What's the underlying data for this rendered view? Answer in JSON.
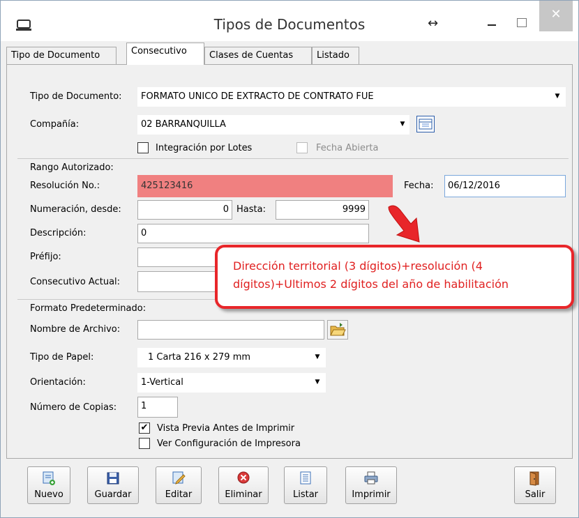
{
  "window": {
    "title": "Tipos de Documentos",
    "resize_glyph": "↔",
    "close_glyph": "✕"
  },
  "tabs": [
    {
      "label": "Tipo de Documento",
      "active": false
    },
    {
      "label": "Consecutivo",
      "active": true
    },
    {
      "label": "Clases de Cuentas",
      "active": false
    },
    {
      "label": "Listado",
      "active": false
    }
  ],
  "form": {
    "tipo_documento_label": "Tipo de Documento:",
    "tipo_documento_value": "FORMATO UNICO DE EXTRACTO DE CONTRATO FUE",
    "compania_label": "Compañía:",
    "compania_value": "02 BARRANQUILLA",
    "integracion_label": "Integración por Lotes",
    "integracion_checked": false,
    "fecha_abierta_label": "Fecha Abierta",
    "fecha_abierta_checked": false,
    "rango_section": "Rango Autorizado:",
    "resolucion_label": "Resolución No.:",
    "resolucion_value": "425123416",
    "fecha_label": "Fecha:",
    "fecha_value": "06/12/2016",
    "numeracion_label": "Numeración, desde:",
    "numeracion_desde": "0",
    "hasta_label": "Hasta:",
    "hasta_value": "9999",
    "descripcion_label": "Descripción:",
    "descripcion_value": "0",
    "prefijo_label": "Préfijo:",
    "prefijo_value": "",
    "consecutivo_actual_label": "Consecutivo Actual:",
    "consecutivo_actual_value": "",
    "formato_section": "Formato Predeterminado:",
    "nombre_archivo_label": "Nombre de Archivo:",
    "nombre_archivo_value": "",
    "tipo_papel_label": "Tipo de Papel:",
    "tipo_papel_value": "1  Carta 216 x 279 mm",
    "orientacion_label": "Orientación:",
    "orientacion_value": "1-Vertical",
    "copias_label": "Número de Copias:",
    "copias_value": "1",
    "vista_previa_label": "Vista Previa Antes de Imprimir",
    "vista_previa_checked": true,
    "ver_config_label": "Ver Configuración de Impresora",
    "ver_config_checked": false,
    "check_glyph": "✔"
  },
  "callout": {
    "line1": "Dirección territorial (3 dígitos)+resolución (4",
    "line2": "dígitos)+Ultimos 2 dígitos del año de habilitación",
    "color": "#e8262a"
  },
  "buttons": {
    "nuevo": "Nuevo",
    "guardar": "Guardar",
    "editar": "Editar",
    "eliminar": "Eliminar",
    "listar": "Listar",
    "imprimir": "Imprimir",
    "salir": "Salir"
  },
  "colors": {
    "highlight": "#f08080",
    "window_bg": "#f0f0f0"
  }
}
